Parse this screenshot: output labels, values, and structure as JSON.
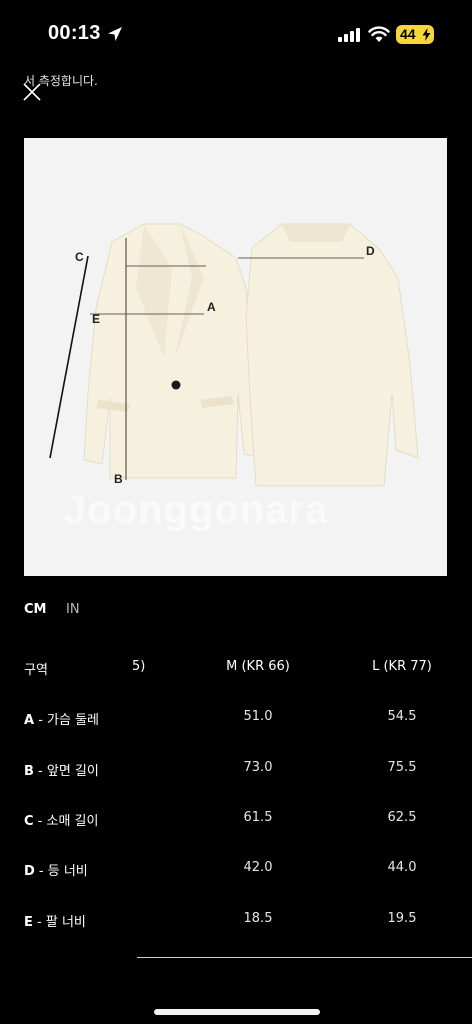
{
  "status_bar": {
    "time": "00:13",
    "battery": "44",
    "colors": {
      "battery": "#f5d73c"
    }
  },
  "header": {
    "text": "서 측정합니다.",
    "close_icon": "close-icon"
  },
  "image": {
    "watermark": "Joonggonara",
    "labels": {
      "a": "A",
      "b": "B",
      "c": "C",
      "d": "D",
      "e": "E"
    }
  },
  "units": {
    "cm": "CM",
    "in": "IN"
  },
  "table": {
    "headers": [
      "구역",
      "5)",
      "M (KR 66)",
      "L (KR 77)"
    ],
    "rows": [
      {
        "code": "A",
        "label": " - 가슴 둘레",
        "m": "51.0",
        "l": "54.5"
      },
      {
        "code": "B",
        "label": " - 앞면 길이",
        "m": "73.0",
        "l": "75.5"
      },
      {
        "code": "C",
        "label": " - 소매 길이",
        "m": "61.5",
        "l": "62.5"
      },
      {
        "code": "D",
        "label": " - 등 너비",
        "m": "42.0",
        "l": "44.0"
      },
      {
        "code": "E",
        "label": " - 팔 너비",
        "m": "18.5",
        "l": "19.5"
      }
    ]
  }
}
